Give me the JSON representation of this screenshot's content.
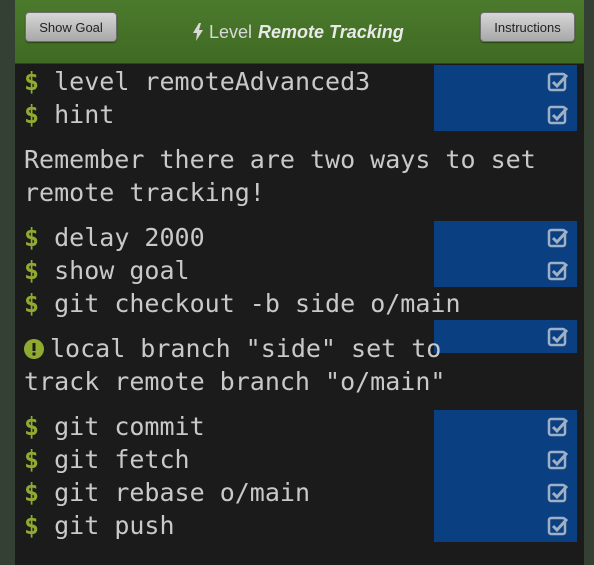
{
  "header": {
    "show_goal_label": "Show Goal",
    "level_prefix": "Level",
    "level_name": "Remote Tracking",
    "instructions_label": "Instructions"
  },
  "terminal": {
    "prompt_symbol": "$",
    "commands_a": [
      {
        "text": "level remoteAdvanced3"
      },
      {
        "text": "hint"
      }
    ],
    "hint_message_line1": "Remember there are two ways to set",
    "hint_message_line2": "remote tracking!",
    "commands_b": [
      {
        "text": "delay 2000"
      },
      {
        "text": "show goal"
      },
      {
        "text": "git checkout -b side o/main"
      }
    ],
    "info_message_line1": "local branch \"side\" set to",
    "info_message_line2": "track remote branch \"o/main\"",
    "commands_c": [
      {
        "text": "git commit"
      },
      {
        "text": "git fetch"
      },
      {
        "text": "git rebase o/main"
      },
      {
        "text": "git push"
      }
    ]
  },
  "colors": {
    "header_green": "#4b7a2c",
    "terminal_bg": "#1b1b1b",
    "prompt_green": "#8faa2e",
    "status_blue": "#0a3f82",
    "text": "#c9c9c9"
  }
}
